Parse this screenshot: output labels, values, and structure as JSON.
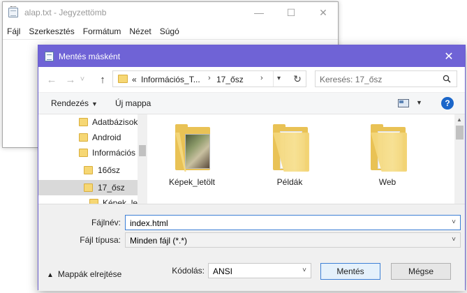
{
  "notepad": {
    "title": "alap.txt - Jegyzettömb",
    "controls": {
      "minimize": "—",
      "maximize": "☐",
      "close": "✕"
    },
    "menu": [
      "Fájl",
      "Szerkesztés",
      "Formátum",
      "Nézet",
      "Súgó"
    ]
  },
  "dialog": {
    "title": "Mentés másként",
    "close": "✕",
    "nav": {
      "back": "←",
      "forward": "→",
      "recent": "˅",
      "up": "↑"
    },
    "address": {
      "prefix": "«",
      "segments": [
        "Információs_T...",
        "17_ősz"
      ],
      "chevron": "›"
    },
    "search": {
      "placeholder": "Keresés: 17_ősz"
    },
    "toolbar": {
      "organize": "Rendezés",
      "new_folder": "Új mappa",
      "help": "?"
    },
    "tree": [
      {
        "label": "Adatbázisok"
      },
      {
        "label": "Android"
      },
      {
        "label": "Információs"
      },
      {
        "label": "16ősz"
      },
      {
        "label": "17_ősz",
        "selected": true
      },
      {
        "label": "Képek_le"
      }
    ],
    "files": [
      {
        "name": "Képek_letölt",
        "type": "folder-photo"
      },
      {
        "name": "Példák",
        "type": "folder"
      },
      {
        "name": "Web",
        "type": "folder"
      }
    ],
    "form": {
      "filename_label": "Fájlnév:",
      "filename_value": "index.html",
      "filetype_label": "Fájl típusa:",
      "filetype_value": "Minden fájl  (*.*)",
      "hide_folders": "Mappák elrejtése",
      "encoding_label": "Kódolás:",
      "encoding_value": "ANSI",
      "save_button": "Mentés",
      "cancel_button": "Mégse"
    }
  },
  "colors": {
    "dialog_title_bar": "#6f63d6",
    "accent": "#3c7fd6",
    "folder": "#f6d774"
  }
}
